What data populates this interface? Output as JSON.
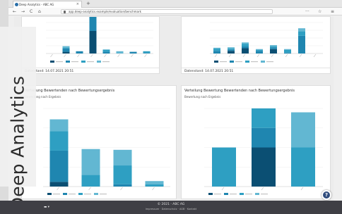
{
  "browser": {
    "tab_title": "Deep Analytics - ABC AG",
    "tab_close": "×",
    "new_tab": "+",
    "url": "app.deep-analytics.example/evaluation/benchmark",
    "nav": {
      "back": "←",
      "forward": "→",
      "reload": "C",
      "home": "⌂"
    },
    "toolbar_right": [
      "···",
      "☆",
      "≡"
    ]
  },
  "brand": {
    "text": "Deep Analytics"
  },
  "colors": {
    "dark": "#0b4f73",
    "mid": "#1f86b0",
    "teal": "#2e9fc2",
    "light": "#62b7d2",
    "pale": "#a9cfdd",
    "black": "#1c1c1c",
    "grey": "#8f9aa3"
  },
  "cards": {
    "top_left_footer": "Datenstand: 14.07.2021 20:51",
    "top_right_footer": "Datenstand: 14.07.2021 20:51",
    "bottom_left_title": "Verteilung Bewertenden nach Bewertungsergebnis",
    "bottom_left_subtitle": "Bewertung nach Ergebnis",
    "bottom_right_title": "Verteilung Bewertung Bewertenden nach Bewertungsergebnis",
    "bottom_right_subtitle": "Bewertung nach Ergebnis"
  },
  "chart_data": [
    {
      "type": "bar",
      "stacked": true,
      "categories": [
        "A",
        "B",
        "C",
        "D",
        "E",
        "F",
        "G",
        "H"
      ],
      "series": [
        {
          "values": [
            0,
            3,
            0,
            40,
            0,
            0,
            0,
            0
          ]
        },
        {
          "values": [
            0,
            6,
            4,
            30,
            3,
            0,
            3,
            1
          ]
        },
        {
          "values": [
            0,
            1,
            0,
            10,
            4,
            0,
            0,
            3
          ]
        },
        {
          "values": [
            0,
            3,
            0,
            0,
            0,
            4,
            0,
            0
          ]
        }
      ],
      "ylim": [
        0,
        55
      ]
    },
    {
      "type": "bar",
      "stacked": true,
      "categories": [
        "A",
        "B",
        "C",
        "D",
        "E",
        "F",
        "G",
        "H"
      ],
      "series": [
        {
          "values": [
            0,
            6,
            12,
            0,
            10,
            0,
            0,
            0
          ]
        },
        {
          "values": [
            6,
            3,
            4,
            6,
            4,
            2,
            40,
            0
          ]
        },
        {
          "values": [
            5,
            2,
            6,
            2,
            2,
            6,
            10,
            0
          ]
        },
        {
          "values": [
            2,
            3,
            3,
            2,
            3,
            2,
            7,
            0
          ]
        }
      ],
      "ylim": [
        0,
        70
      ]
    },
    {
      "type": "bar",
      "stacked": true,
      "categories": [
        "",
        "",
        "",
        ""
      ],
      "series": [
        {
          "values": [
            6,
            0,
            0,
            0
          ]
        },
        {
          "values": [
            40,
            0,
            3,
            0
          ]
        },
        {
          "values": [
            25,
            15,
            24,
            3
          ]
        },
        {
          "values": [
            15,
            33,
            20,
            4
          ]
        }
      ],
      "ylim": [
        0,
        100
      ]
    },
    {
      "type": "bar",
      "stacked": true,
      "categories": [
        "",
        "",
        ""
      ],
      "series": [
        {
          "values": [
            0,
            1,
            0
          ]
        },
        {
          "values": [
            0,
            0.5,
            0
          ]
        },
        {
          "values": [
            1,
            0.5,
            1
          ]
        },
        {
          "values": [
            0,
            0,
            0.9
          ]
        }
      ],
      "ylim": [
        0,
        2
      ]
    }
  ]
}
